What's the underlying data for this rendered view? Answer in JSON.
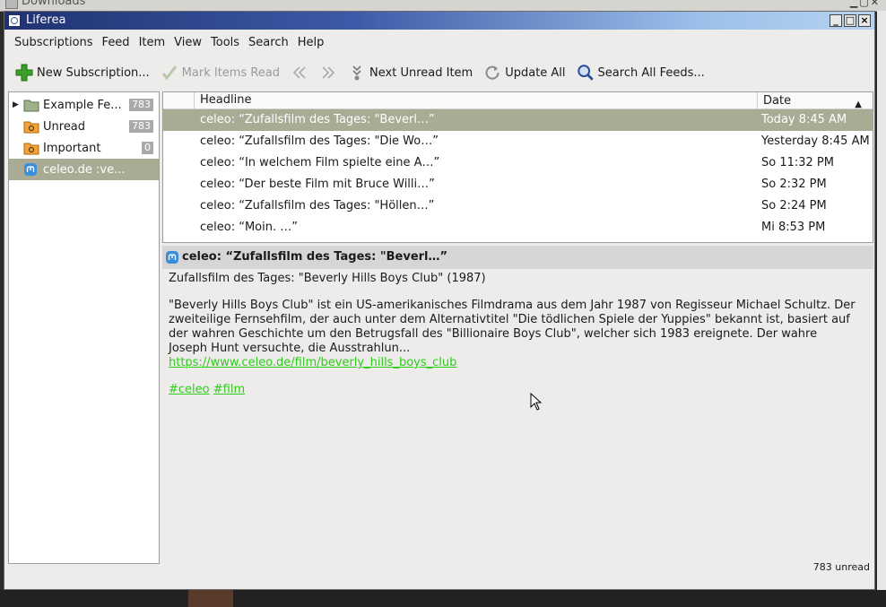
{
  "background": {
    "top_window_title": "Downloads"
  },
  "window": {
    "title": "Liferea",
    "controls": [
      "_",
      "□",
      "×"
    ]
  },
  "menu": [
    "Subscriptions",
    "Feed",
    "Item",
    "View",
    "Tools",
    "Search",
    "Help"
  ],
  "toolbar": {
    "new_subscription": "New Subscription...",
    "mark_items_read": "Mark Items Read",
    "next_unread": "Next Unread Item",
    "update_all": "Update All",
    "search_all": "Search All Feeds..."
  },
  "feeds": [
    {
      "label": "Example Fe...",
      "count": "783",
      "icon": "folder-icon"
    },
    {
      "label": "Unread",
      "count": "783",
      "icon": "search-folder-icon"
    },
    {
      "label": "Important",
      "count": "0",
      "icon": "search-folder-icon"
    },
    {
      "label": "celeo.de :ve...",
      "count": "",
      "icon": "mastodon-icon"
    }
  ],
  "headlines": {
    "columns": {
      "headline": "Headline",
      "date": "Date"
    },
    "rows": [
      {
        "headline": "celeo: “Zufallsfilm des Tages: \"Beverl…”",
        "date": "Today 8:45 AM"
      },
      {
        "headline": "celeo: “Zufallsfilm des Tages: \"Die Wo…”",
        "date": "Yesterday 8:45 AM"
      },
      {
        "headline": "celeo: “In welchem Film spielte eine A…”",
        "date": "So 11:32 PM"
      },
      {
        "headline": "celeo: “Der beste Film mit Bruce Willi…”",
        "date": "So 2:32 PM"
      },
      {
        "headline": "celeo: “Zufallsfilm des Tages: \"Höllen…”",
        "date": "So 2:24 PM"
      },
      {
        "headline": "celeo: “Moin. …”",
        "date": "Mi 8:53 PM"
      }
    ]
  },
  "item": {
    "title": "celeo: “Zufallsfilm des Tages: \"Beverl…”",
    "line1": "Zufallsfilm des Tages: \"Beverly Hills Boys Club\" (1987)",
    "body": "\"Beverly Hills Boys Club\" ist ein US-amerikanisches Filmdrama aus dem Jahr 1987 von Regisseur Michael Schultz. Der zweiteilige Fernsehfilm, der auch unter dem Alternativtitel \"Die tödlichen Spiele der Yuppies\" bekannt ist, basiert auf der wahren Geschichte um den Betrugsfall des \"Billionaire Boys Club\", welcher sich 1983 ereignete. Der wahre Joseph Hunt versuchte, die Ausstrahlun...",
    "link": "https://www.celeo.de/film/beverly_hills_boys_club",
    "tags": [
      "#celeo",
      "#film"
    ]
  },
  "status": "783 unread",
  "colors": {
    "selection": "#a9ab95",
    "link": "#2ecc1a",
    "title_gradient_start": "#1f3270"
  }
}
